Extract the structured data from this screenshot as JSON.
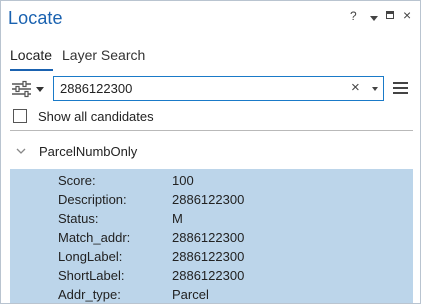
{
  "window": {
    "title": "Locate",
    "help": "?",
    "close": "×"
  },
  "tabs": [
    {
      "label": "Locate",
      "active": true
    },
    {
      "label": "Layer Search",
      "active": false
    }
  ],
  "search": {
    "value": "2886122300",
    "clear": "×"
  },
  "options": {
    "show_all_label": "Show all candidates",
    "show_all_checked": false
  },
  "group": {
    "label": "ParcelNumbOnly",
    "expanded": true
  },
  "result": {
    "fields": [
      {
        "key": "Score:",
        "value": "100"
      },
      {
        "key": "Description:",
        "value": "2886122300"
      },
      {
        "key": "Status:",
        "value": "M"
      },
      {
        "key": "Match_addr:",
        "value": "2886122300"
      },
      {
        "key": "LongLabel:",
        "value": "2886122300"
      },
      {
        "key": "ShortLabel:",
        "value": "2886122300"
      },
      {
        "key": "Addr_type:",
        "value": "Parcel"
      }
    ]
  },
  "colors": {
    "accent": "#1a62b0",
    "selection": "#bcd5ea",
    "input_border": "#1a7ac8"
  },
  "icons": [
    "help-icon",
    "pane-options-icon",
    "restore-icon",
    "close-icon",
    "filter-settings-icon",
    "dropdown-icon",
    "clear-icon",
    "menu-icon",
    "checkbox",
    "chevron-down-icon"
  ]
}
